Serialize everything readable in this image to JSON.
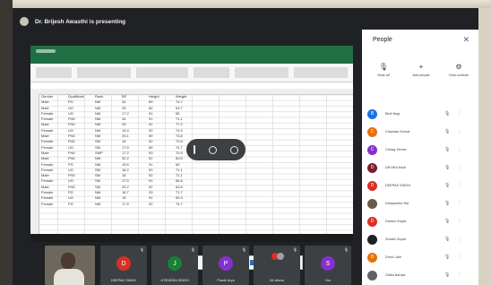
{
  "meeting": {
    "presenting_banner": "Dr. Brijesh Awasthi is presenting"
  },
  "spreadsheet": {
    "headers": [
      "Gender",
      "Qualificati",
      "Rank",
      "BP",
      "Height",
      "Weight"
    ],
    "rows": [
      [
        "Male",
        "PG",
        "NM",
        "34",
        "89",
        "74.7"
      ],
      [
        "Male",
        "UG",
        "NM",
        "25",
        "84",
        "63.7"
      ],
      [
        "Female",
        "UG",
        "NM",
        "17.2",
        "91",
        "65"
      ],
      [
        "Female",
        "PhD",
        "NM",
        "34",
        "91",
        "71.1"
      ],
      [
        "Male",
        "PhD",
        "NM",
        "25",
        "91",
        "77.2"
      ],
      [
        "Female",
        "UG",
        "NM",
        "15.4",
        "92",
        "74.9"
      ],
      [
        "Male",
        "PhD",
        "NM",
        "25.1",
        "89",
        "73.6"
      ],
      [
        "Female",
        "PhD",
        "SM",
        "18",
        "92",
        "72.8"
      ],
      [
        "Female",
        "UG",
        "SM",
        "17.5",
        "89",
        "74.7"
      ],
      [
        "Male",
        "PhD",
        "SMP",
        "17.2",
        "93",
        "70.9"
      ],
      [
        "Male",
        "PhD",
        "NM",
        "32.2",
        "92",
        "83.5"
      ],
      [
        "Female",
        "PG",
        "NM",
        "19.5",
        "91",
        "65"
      ],
      [
        "Female",
        "UG",
        "SM",
        "16.2",
        "93",
        "71.1"
      ],
      [
        "Male",
        "PhD",
        "SM",
        "18",
        "92",
        "72.1"
      ],
      [
        "Female",
        "UG",
        "SM",
        "17.5",
        "91",
        "84.8"
      ],
      [
        "Male",
        "PhD",
        "SM",
        "25.2",
        "92",
        "63.6"
      ],
      [
        "Female",
        "PG",
        "NM",
        "18.7",
        "93",
        "71.7"
      ],
      [
        "Female",
        "UG",
        "NM",
        "18",
        "91",
        "65.3"
      ],
      [
        "Female",
        "PG",
        "NM",
        "17.5",
        "92",
        "74.7"
      ]
    ]
  },
  "people_panel": {
    "title": "People",
    "actions": [
      {
        "icon": "mute-all-icon",
        "label": "Mute all"
      },
      {
        "icon": "add-people-icon",
        "label": "Add people"
      },
      {
        "icon": "host-controls-icon",
        "label": "Host controls"
      }
    ],
    "participants": [
      {
        "initial": "B",
        "name": "Binit Negi",
        "color": "#1a73e8"
      },
      {
        "initial": "C",
        "name": "Chandan Kumar",
        "color": "#e8710a"
      },
      {
        "initial": "C",
        "name": "Chirag Verma",
        "color": "#8430ce"
      },
      {
        "initial": "D",
        "name": "DEVIKA Modi",
        "color": "#7b1f2c"
      },
      {
        "initial": "D",
        "name": "DEEPAK SINGH",
        "color": "#d93025"
      },
      {
        "initial": "",
        "name": "Deepanshu Rai",
        "color": "#6b5a4a"
      },
      {
        "initial": "D",
        "name": "Dinesh Gupta",
        "color": "#d93025"
      },
      {
        "initial": "",
        "name": "Shalini Gupta",
        "color": "#202124"
      },
      {
        "initial": "D",
        "name": "Dhruv Jain",
        "color": "#e8710a"
      },
      {
        "initial": "",
        "name": "Gitika Bansal",
        "color": "#5f6368"
      }
    ]
  },
  "tiles": [
    {
      "initial": "D",
      "name": "DEEPAK SINGH",
      "color": "#d93025"
    },
    {
      "initial": "J",
      "name": "JITENDRA SINGH",
      "color": "#188038"
    },
    {
      "initial": "P",
      "name": "Prachi Arya",
      "color": "#8430ce"
    },
    {
      "initial": "",
      "name": "26 others",
      "color": "#d93025"
    },
    {
      "initial": "S",
      "name": "You",
      "color": "#8430ce"
    }
  ],
  "colors": {
    "excel_green": "#1f6f43",
    "meet_background": "#202124",
    "panel_background": "#ffffff"
  }
}
